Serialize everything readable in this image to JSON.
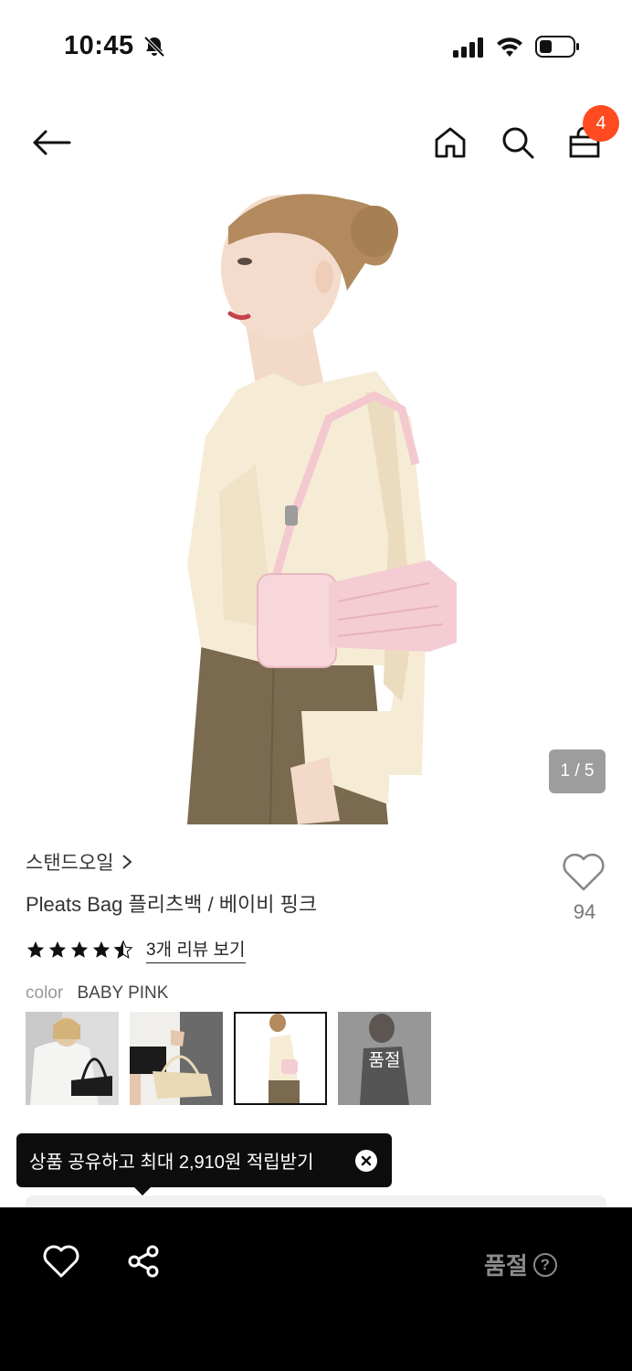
{
  "status_bar": {
    "time": "10:45"
  },
  "nav": {
    "cart_count": "4"
  },
  "hero": {
    "image_counter": "1 / 5"
  },
  "product": {
    "brand": "스탠드오일",
    "title": "Pleats Bag 플리츠백 / 베이비 핑크",
    "wish_count": "94",
    "rating": 4.5,
    "review_link": "3개 리뷰 보기",
    "color_label": "color",
    "color_value": "BABY PINK"
  },
  "thumbnails": [
    {
      "selected": false,
      "sold_out": false
    },
    {
      "selected": false,
      "sold_out": false
    },
    {
      "selected": true,
      "sold_out": false
    },
    {
      "selected": false,
      "sold_out": true,
      "label": "품절"
    }
  ],
  "tooltip": {
    "text": "상품 공유하고 최대 2,910원 적립받기"
  },
  "bottom_bar": {
    "status_label": "품절",
    "help_glyph": "?"
  },
  "colors": {
    "accent_badge": "#ff4b1f",
    "bottom_bar": "#000000",
    "soldout_text": "#8a8a8a"
  }
}
